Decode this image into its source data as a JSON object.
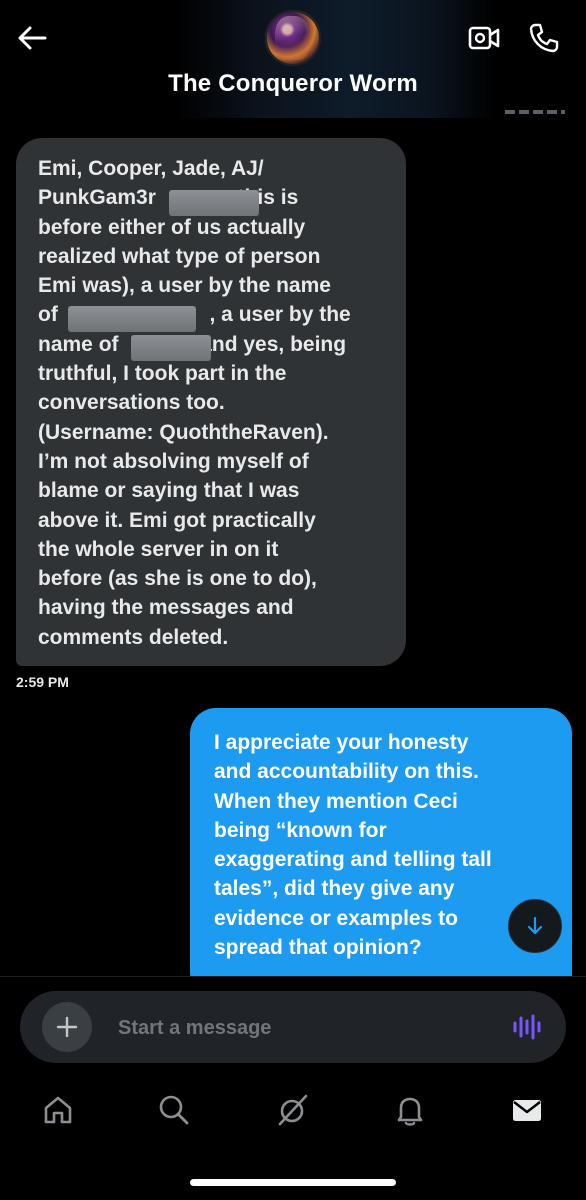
{
  "header": {
    "title": "The Conqueror Worm"
  },
  "messages": [
    {
      "direction": "incoming",
      "lines": [
        "Emi, Cooper, Jade, AJ/",
        "PunkGam3r              this is",
        "before either of us actually",
        "realized what type of person",
        "Emi was), a user by the name",
        "of                          , a user by the",
        "name of              and yes, being",
        "truthful, I took part in the",
        "conversations too.",
        "(Username: QuoththeRaven).",
        "I’m not absolving myself of",
        "blame or saying that I was",
        "above it. Emi got practically",
        "the whole server in on it",
        "before (as she is one to do),",
        "having the messages and",
        "comments deleted."
      ],
      "time": "2:59 PM"
    },
    {
      "direction": "outgoing",
      "lines": [
        "I appreciate your honesty",
        "and accountability on this.",
        "When they mention Ceci",
        "being “known for",
        "exaggerating and telling tall",
        "tales”, did they give any",
        "evidence or examples to",
        "spread that opinion?"
      ]
    }
  ],
  "composer": {
    "placeholder": "Start a message"
  },
  "colors": {
    "background": "#000000",
    "incoming_bubble": "#2f3336",
    "outgoing_bubble": "#1d9bf0",
    "voice_accent": "#7856ff"
  },
  "icons": {
    "back": "arrow-left-icon",
    "video": "video-camera-icon",
    "phone": "phone-icon",
    "scroll": "arrow-down-icon",
    "plus": "plus-icon",
    "voice": "voice-wave-icon",
    "tabs": [
      "home-icon",
      "search-icon",
      "grok-icon",
      "bell-icon",
      "mail-icon"
    ]
  }
}
